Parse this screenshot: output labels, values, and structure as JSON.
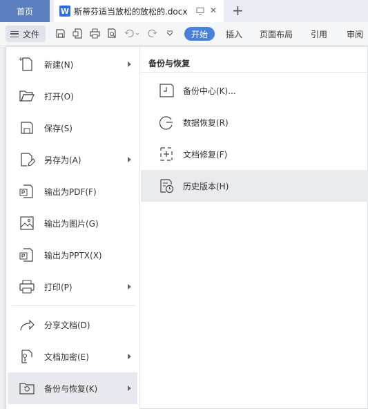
{
  "tabs": {
    "home": "首页",
    "doc_icon_letter": "W",
    "doc_title": "斯蒂芬适当放松的放松的.docx",
    "close": "✕",
    "new": "+"
  },
  "toolbar": {
    "file_label": "文件",
    "ribbon_tabs": [
      "开始",
      "插入",
      "页面布局",
      "引用",
      "审阅"
    ]
  },
  "file_menu": {
    "items": [
      {
        "label": "新建(N)",
        "icon": "new-doc-icon",
        "has_submenu": true
      },
      {
        "label": "打开(O)",
        "icon": "folder-open-icon",
        "has_submenu": false
      },
      {
        "label": "保存(S)",
        "icon": "save-icon",
        "has_submenu": false
      },
      {
        "label": "另存为(A)",
        "icon": "save-as-icon",
        "has_submenu": true
      },
      {
        "label": "输出为PDF(F)",
        "icon": "export-pdf-icon",
        "has_submenu": false
      },
      {
        "label": "输出为图片(G)",
        "icon": "export-image-icon",
        "has_submenu": false
      },
      {
        "label": "输出为PPTX(X)",
        "icon": "export-pptx-icon",
        "has_submenu": false
      },
      {
        "label": "打印(P)",
        "icon": "print-icon",
        "has_submenu": true
      },
      {
        "label": "分享文档(D)",
        "icon": "share-icon",
        "has_submenu": false
      },
      {
        "label": "文档加密(E)",
        "icon": "encrypt-doc-icon",
        "has_submenu": true
      },
      {
        "label": "备份与恢复(K)",
        "icon": "backup-restore-icon",
        "has_submenu": true,
        "active": true
      }
    ]
  },
  "submenu": {
    "title": "备份与恢复",
    "items": [
      {
        "label": "备份中心(K)...",
        "icon": "backup-center-icon"
      },
      {
        "label": "数据恢复(R)",
        "icon": "data-recovery-icon"
      },
      {
        "label": "文档修复(F)",
        "icon": "doc-repair-icon"
      },
      {
        "label": "历史版本(H)",
        "icon": "history-version-icon",
        "hover": true
      }
    ]
  },
  "colors": {
    "accent": "#4a81d8",
    "home_tab": "#5b80bd",
    "active_item_bg": "#e7e9ee"
  }
}
